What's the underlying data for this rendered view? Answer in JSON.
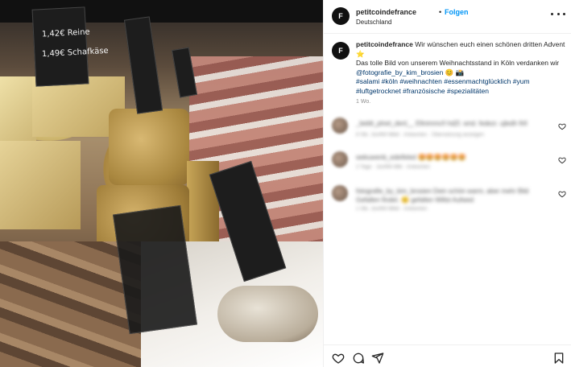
{
  "photo": {
    "sign1_line1": "1,42€ Reine",
    "sign1_line2": "1,49€ Schafkäse"
  },
  "header": {
    "username": "petitcoindefrance",
    "separator": "•",
    "follow_label": "Folgen",
    "location": "Deutschland",
    "avatar_glyph": "F"
  },
  "caption": {
    "username": "petitcoindefrance",
    "line1": "Wir wünschen euch einen schönen dritten Advent ⭐",
    "line2_prefix": "Das tolle Bild von unserem Weihnachtsstand in Köln verdanken wir ",
    "mention": "@fotografie_by_kim_brosien",
    "line2_suffix": " 😊 📸",
    "hashtags": [
      "#salami",
      "#köln",
      "#weihnachten",
      "#essenmachtglücklich",
      "#yum",
      "#luftgetrocknet",
      "#französische",
      "#spezialitäten"
    ],
    "time": "1 Wo."
  },
  "comments": [
    {
      "text": "_beblt_plnet_denl__ Ellnimmcñ hdZl. wnd. fedezr. ujledh firll",
      "meta": "8 Stk.  1kofWi Mbkl  ·  Antwortes  ·  Übersetzung anzeigen"
    },
    {
      "text": "wekuwenb_edeifeled 🤩🤩🤩🤩🤩🤩",
      "meta": "2 Tage  ·  1kofWi Mbl  ·  Antworten"
    },
    {
      "text": "fotografie_by_kim_brosien Dein schön warm, aber mehr Bild Gefallen findet. 😊 gefallen Willst Aufwed",
      "meta": "1 Stk.  1kofWi Mbkl  ·  Antworten"
    }
  ],
  "actions": [
    "heart-icon",
    "comment-icon",
    "share-icon",
    "bookmark-icon"
  ]
}
